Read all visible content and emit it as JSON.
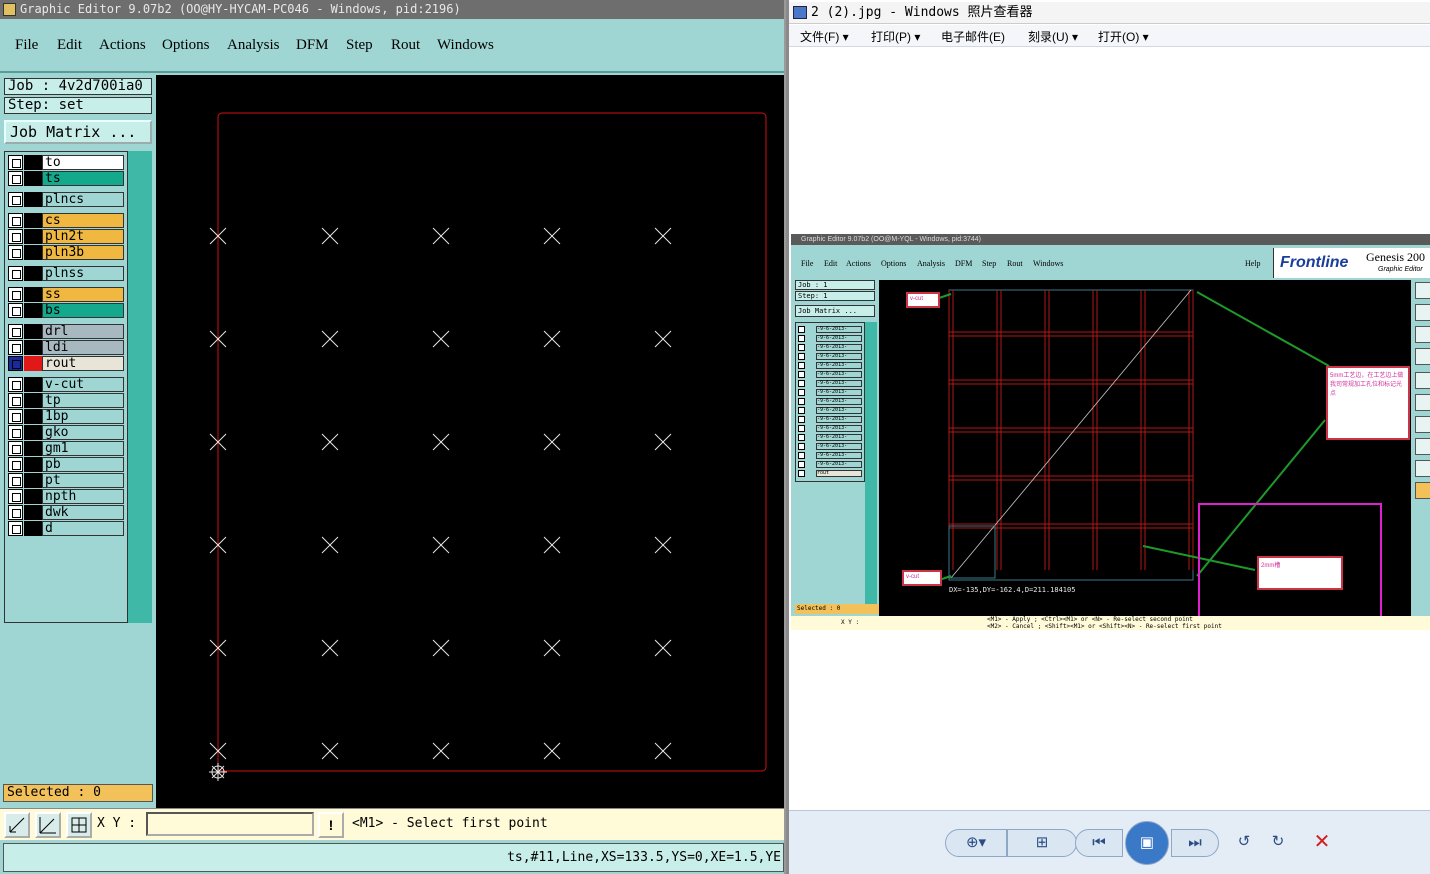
{
  "editor": {
    "title": "Graphic Editor 9.07b2 (OO@HY-HYCAM-PC046 - Windows, pid:2196)",
    "menu": [
      "File",
      "Edit",
      "Actions",
      "Options",
      "Analysis",
      "DFM",
      "Step",
      "Rout",
      "Windows"
    ],
    "job": "Job : 4v2d700ia0",
    "step": "Step: set",
    "job_matrix": "Job Matrix ...",
    "layers": [
      {
        "name": "to",
        "color": "#ffffff"
      },
      {
        "name": "ts",
        "color": "#14a88c"
      },
      {
        "name": "plncs",
        "color": "#9fd6d3"
      },
      {
        "name": "cs",
        "color": "#f0b840"
      },
      {
        "name": "pln2t",
        "color": "#f0b840"
      },
      {
        "name": "pln3b",
        "color": "#f0b840"
      },
      {
        "name": "plnss",
        "color": "#9fd6d3"
      },
      {
        "name": "ss",
        "color": "#f0b840"
      },
      {
        "name": "bs",
        "color": "#14a88c"
      },
      {
        "name": "drl",
        "color": "#a8b8c0"
      },
      {
        "name": "ldi",
        "color": "#a8b8c0"
      },
      {
        "name": "rout",
        "color": "#e8e4d8"
      },
      {
        "name": "v-cut",
        "color": "#9fd6d3"
      },
      {
        "name": "tp",
        "color": "#9fd6d3"
      },
      {
        "name": "1bp",
        "color": "#9fd6d3"
      },
      {
        "name": "gko",
        "color": "#9fd6d3"
      },
      {
        "name": "gm1",
        "color": "#9fd6d3"
      },
      {
        "name": "pb",
        "color": "#9fd6d3"
      },
      {
        "name": "pt",
        "color": "#9fd6d3"
      },
      {
        "name": "npth",
        "color": "#9fd6d3"
      },
      {
        "name": "dwk",
        "color": "#9fd6d3"
      },
      {
        "name": "d",
        "color": "#9fd6d3"
      }
    ],
    "selected": "Selected : 0",
    "xy_label": "X Y :",
    "prompt": "<M1> - Select first point",
    "status": "ts,#11,Line,XS=133.5,YS=0,XE=1.5,YE"
  },
  "viewer": {
    "title": "2 (2).jpg - Windows 照片查看器",
    "menu": [
      "文件(F) ▾",
      "打印(P) ▾",
      "电子邮件(E)",
      "刻录(U) ▾",
      "打开(O) ▾"
    ],
    "inner": {
      "title": "Graphic Editor 9.07b2 (OO@M-YQL - Windows, pid:3744)",
      "menu": [
        "File",
        "Edit",
        "Actions",
        "Options",
        "Analysis",
        "DFM",
        "Step",
        "Rout",
        "Windows",
        "Help"
      ],
      "logo": "Frontline",
      "product": "Genesis 200",
      "product_sub": "Graphic Editor",
      "job": "Job : 1",
      "step": "Step: 1",
      "job_matrix": "Job Matrix ...",
      "layers": [
        "-9-6-2013-",
        "-9-6-2013-",
        "-9-6-2013-",
        "-9-6-2013-",
        "-9-6-2013-",
        "-9-6-2013-",
        "-9-6-2013-",
        "-9-6-2013-",
        "-9-6-2013-",
        "-9-6-2013-",
        "-9-6-2013-",
        "-9-6-2013-",
        "-9-6-2013-",
        "-9-6-2013-",
        "-9-6-2013-",
        "-9-6-2013-",
        "rout"
      ],
      "selected": "Selected : 0",
      "measure": "DX=-135,DY=-162.4,D=211.184105",
      "anno_vcut1": "v-cut",
      "anno_vcut2": "v-cut",
      "anno_note1": "5mm工艺边，在工艺边上做我司常规加工孔位和标记光点",
      "anno_note2": "2mm槽",
      "xy_label": "X Y :",
      "prompt1": "<M1> - Apply ; <Ctrl><M1> or <N> - Re-select second point",
      "prompt2": "<M2> - Cancel ; <Shift><M1> or <Shift><N> - Re-select first point"
    }
  }
}
